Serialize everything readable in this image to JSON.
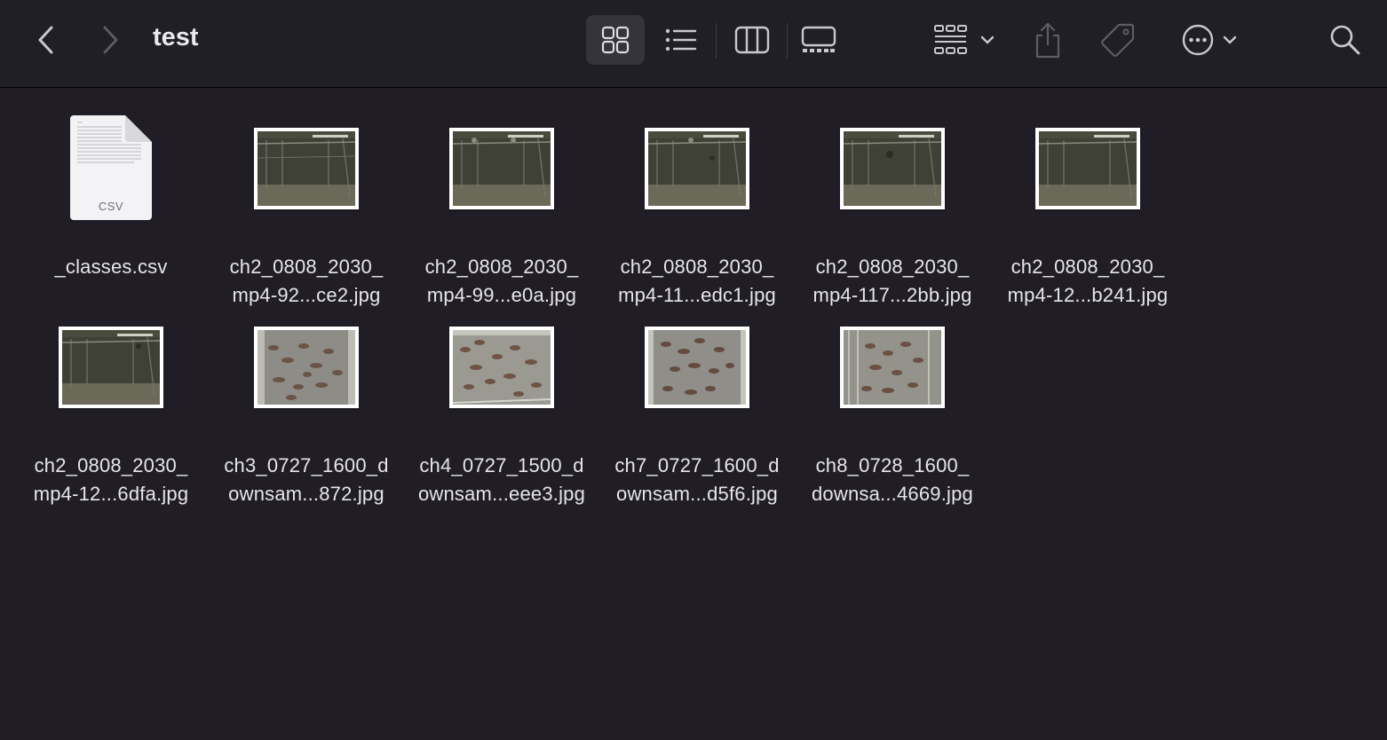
{
  "window": {
    "title": "test"
  },
  "toolbar": {
    "back_icon": "chevron-left-icon",
    "forward_icon": "chevron-right-icon",
    "views": [
      "icon-view",
      "list-view",
      "column-view",
      "gallery-view"
    ],
    "active_view": "icon-view",
    "group_icon": "group-by-icon",
    "share_icon": "share-icon",
    "tag_icon": "tag-icon",
    "more_icon": "ellipsis-circle-icon",
    "search_icon": "magnifying-glass-icon"
  },
  "files": [
    {
      "line1": "_classes.csv",
      "line2": "",
      "kind": "csv",
      "badge": "CSV"
    },
    {
      "line1": "ch2_0808_2030_",
      "line2": "mp4-92...ce2.jpg",
      "kind": "jpg-pen"
    },
    {
      "line1": "ch2_0808_2030_",
      "line2": "mp4-99...e0a.jpg",
      "kind": "jpg-pen"
    },
    {
      "line1": "ch2_0808_2030_",
      "line2": "mp4-11...edc1.jpg",
      "kind": "jpg-pen"
    },
    {
      "line1": "ch2_0808_2030_",
      "line2": "mp4-117...2bb.jpg",
      "kind": "jpg-pen"
    },
    {
      "line1": "ch2_0808_2030_",
      "line2": "mp4-12...b241.jpg",
      "kind": "jpg-pen"
    },
    {
      "line1": "ch2_0808_2030_",
      "line2": "mp4-12...6dfa.jpg",
      "kind": "jpg-pen"
    },
    {
      "line1": "ch3_0727_1600_d",
      "line2": "ownsam...872.jpg",
      "kind": "jpg-herd"
    },
    {
      "line1": "ch4_0727_1500_d",
      "line2": "ownsam...eee3.jpg",
      "kind": "jpg-herd"
    },
    {
      "line1": "ch7_0727_1600_d",
      "line2": "ownsam...d5f6.jpg",
      "kind": "jpg-herd"
    },
    {
      "line1": "ch8_0728_1600_",
      "line2": "downsa...4669.jpg",
      "kind": "jpg-herd"
    }
  ]
}
